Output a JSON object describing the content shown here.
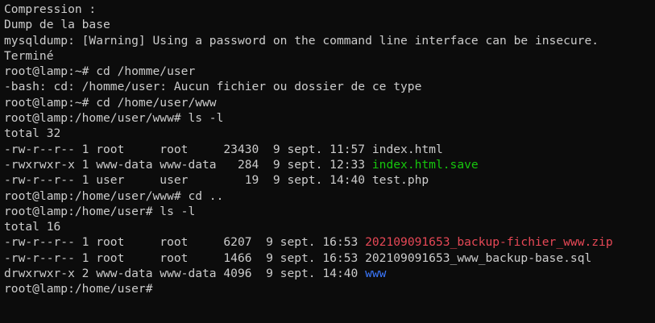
{
  "terminal": {
    "lines": [
      "Compression :",
      "Dump de la base",
      "mysqldump: [Warning] Using a password on the command line interface can be insecure.",
      "Terminé",
      "root@lamp:~# cd /homme/user",
      "-bash: cd: /homme/user: Aucun fichier ou dossier de ce type",
      "root@lamp:~# cd /home/user/www",
      "root@lamp:/home/user/www# ls -l",
      "total 32"
    ],
    "listing1": [
      {
        "meta": "-rw-r--r-- 1 root     root     23430  9 sept. 11:57 ",
        "name": "index.html"
      },
      {
        "meta": "-rwxrwxr-x 1 www-data www-data   284  9 sept. 12:33 ",
        "name": "index.html.save"
      },
      {
        "meta": "-rw-r--r-- 1 user     user        19  9 sept. 14:40 ",
        "name": "test.php"
      }
    ],
    "middle_lines": [
      "root@lamp:/home/user/www# cd ..",
      "root@lamp:/home/user# ls -l",
      "total 16"
    ],
    "listing2": [
      {
        "meta": "-rw-r--r-- 1 root     root     6207  9 sept. 16:53 ",
        "name": "202109091653_backup-fichier_www.zip"
      },
      {
        "meta": "-rw-r--r-- 1 root     root     1466  9 sept. 16:53 ",
        "name": "202109091653_www_backup-base.sql"
      },
      {
        "meta": "drwxrwxr-x 2 www-data www-data 4096  9 sept. 14:40 ",
        "name": "www"
      }
    ],
    "prompt": "root@lamp:/home/user# ",
    "colors": {
      "background": "#0c0c0c",
      "text": "#cccccc",
      "executable": "#16c60c",
      "archive": "#e74856",
      "directory": "#3b78ff"
    }
  }
}
